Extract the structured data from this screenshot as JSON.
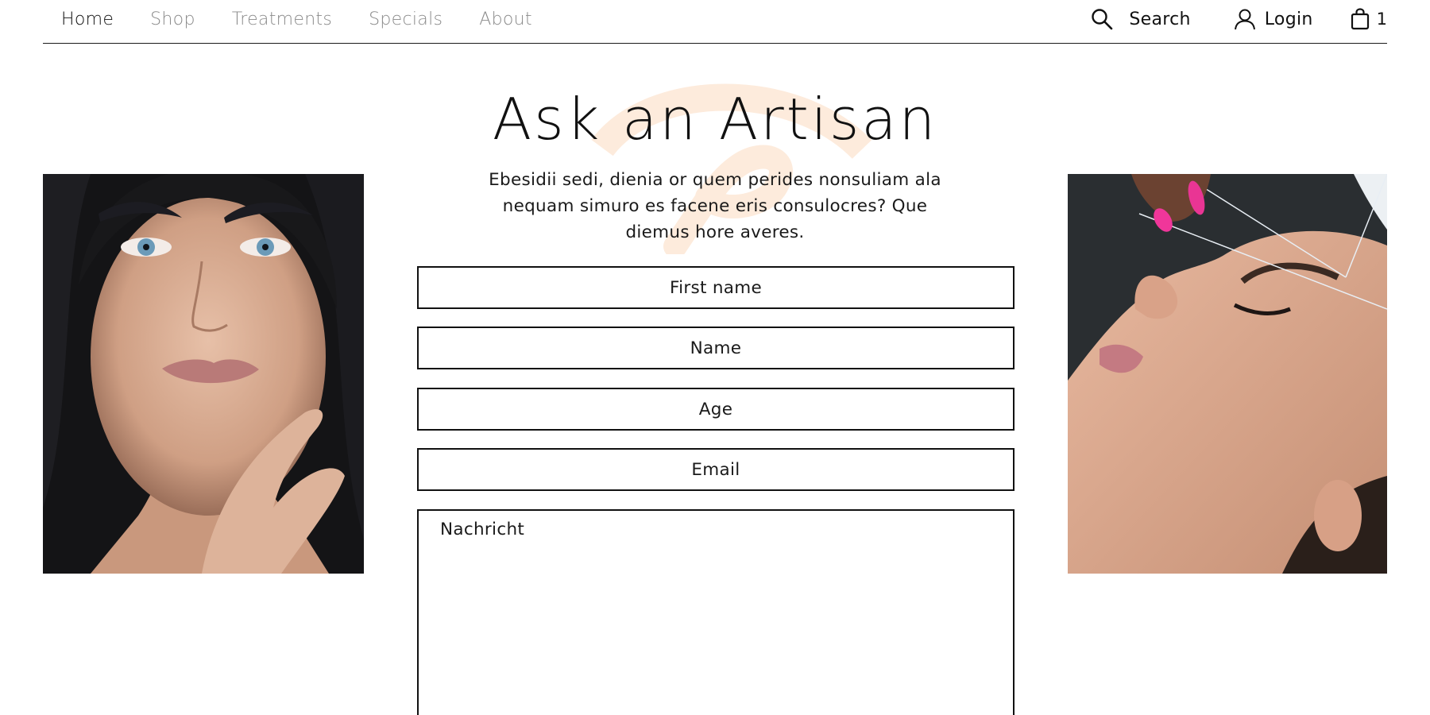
{
  "nav": {
    "items": [
      {
        "label": "Home",
        "active": true
      },
      {
        "label": "Shop",
        "active": false
      },
      {
        "label": "Treatments",
        "active": false
      },
      {
        "label": "Specials",
        "active": false
      },
      {
        "label": "About",
        "active": false
      }
    ],
    "search_label": "Search",
    "login_label": "Login",
    "cart_count": "1",
    "icons": {
      "search": "search-icon",
      "login": "user-icon",
      "cart": "shopping-bag-icon"
    }
  },
  "page": {
    "title": "Ask an Artisan",
    "intro": "Ebesidii sedi, dienia or quem perides nonsuliam ala nequam simuro es facene eris consulocres? Que diemus hore averes."
  },
  "form": {
    "first_name_placeholder": "First name",
    "name_placeholder": "Name",
    "age_placeholder": "Age",
    "email_placeholder": "Email",
    "message_placeholder": "Nachricht"
  },
  "images": {
    "left": "portrait-woman-blue-eyes",
    "right": "eyebrow-threading-treatment"
  },
  "colors": {
    "accent_swoosh": "#fdebdc",
    "text": "#111111",
    "nav_inactive": "#8a8a8a"
  }
}
